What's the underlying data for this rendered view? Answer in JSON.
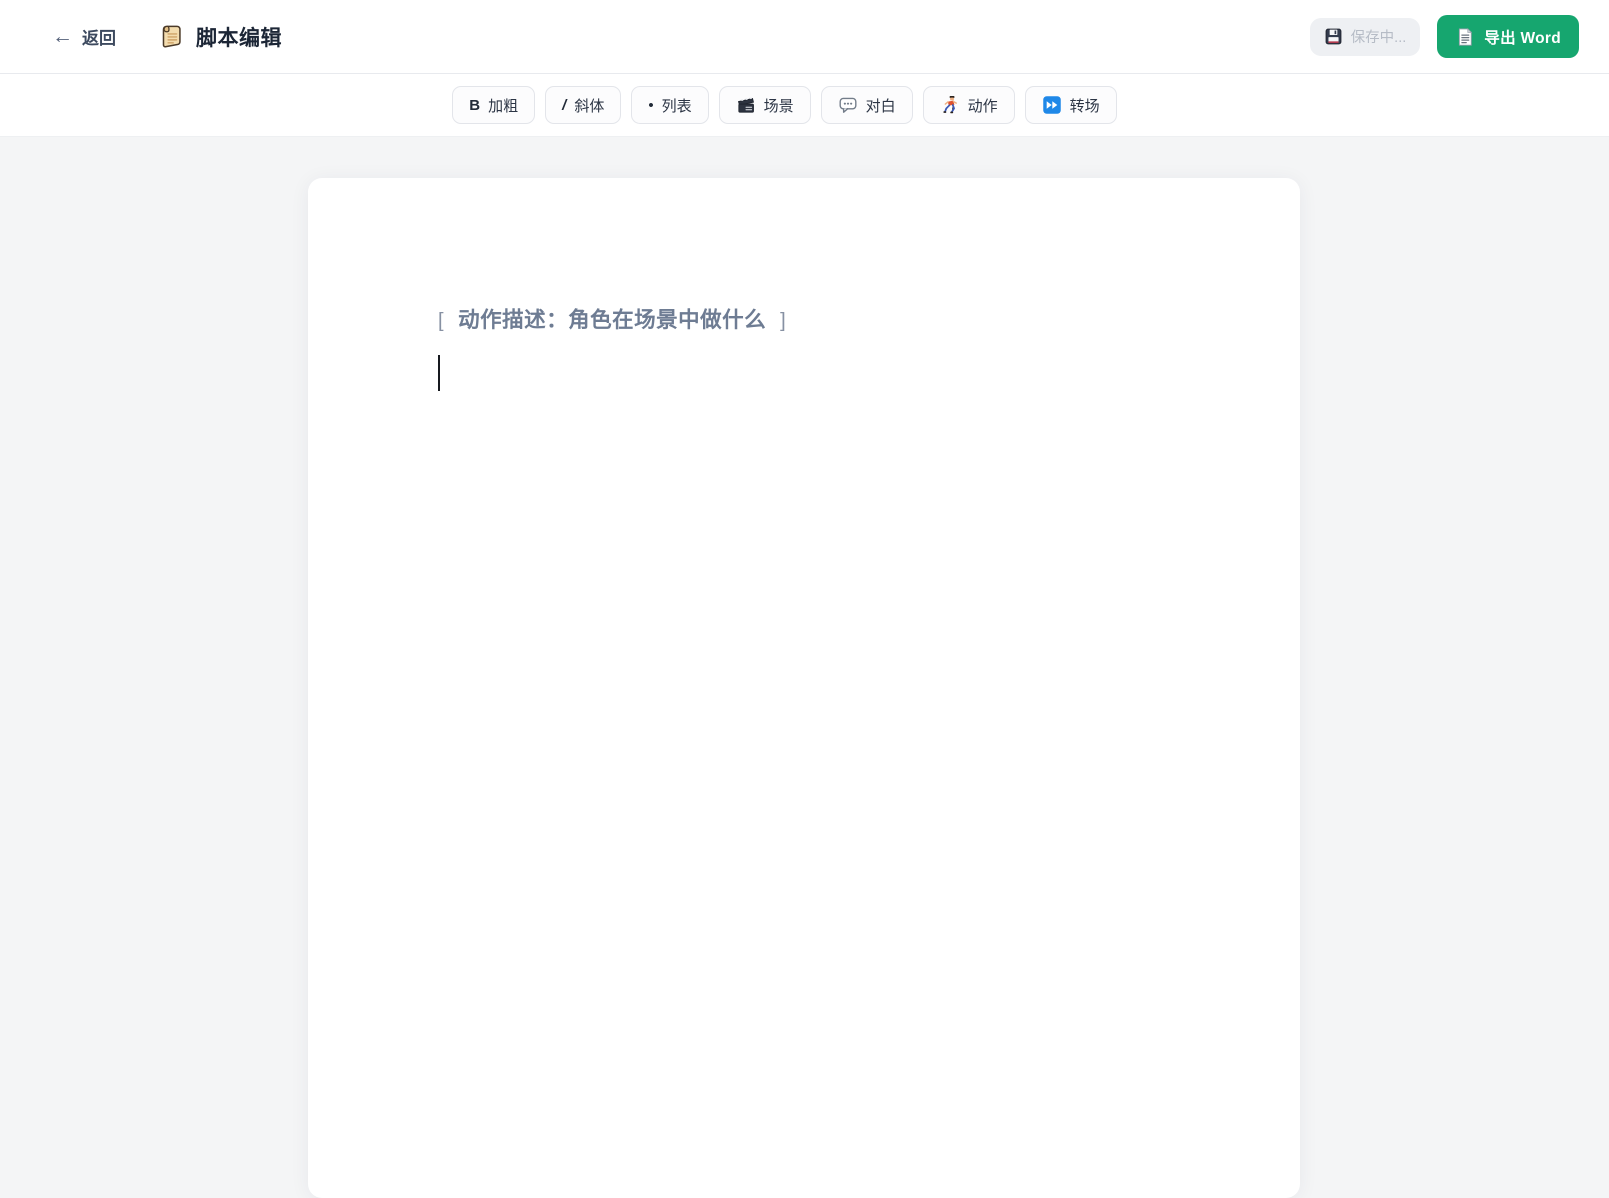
{
  "header": {
    "back": {
      "icon": "←",
      "label": "返回"
    },
    "title": {
      "icon_name": "scroll-icon",
      "text": "脚本编辑"
    },
    "save": {
      "icon_name": "floppy-disk-icon",
      "label": "保存中..."
    },
    "export": {
      "icon_name": "document-icon",
      "label": "导出 Word"
    }
  },
  "toolbar": {
    "buttons": [
      {
        "id": "bold",
        "glyph": "B",
        "label": "加粗"
      },
      {
        "id": "italic",
        "glyph": "/",
        "label": "斜体"
      },
      {
        "id": "list",
        "glyph": "•",
        "label": "列表"
      },
      {
        "id": "scene",
        "icon_name": "clapperboard-icon",
        "label": "场景"
      },
      {
        "id": "dialogue",
        "icon_name": "speech-balloon-icon",
        "label": "对白"
      },
      {
        "id": "action",
        "icon_name": "runner-icon",
        "label": "动作"
      },
      {
        "id": "transition",
        "icon_name": "fast-forward-icon",
        "label": "转场"
      }
    ]
  },
  "editor": {
    "placeholder": {
      "open_bracket": "[",
      "text": "动作描述：角色在场景中做什么",
      "close_bracket": "]"
    }
  },
  "colors": {
    "accent_green": "#16a66f",
    "page_background": "#f4f5f6",
    "card_background": "#ffffff",
    "placeholder_text": "#6e7c93",
    "save_status_text": "#b6bcc6",
    "transition_icon_blue": "#1f88e8"
  }
}
